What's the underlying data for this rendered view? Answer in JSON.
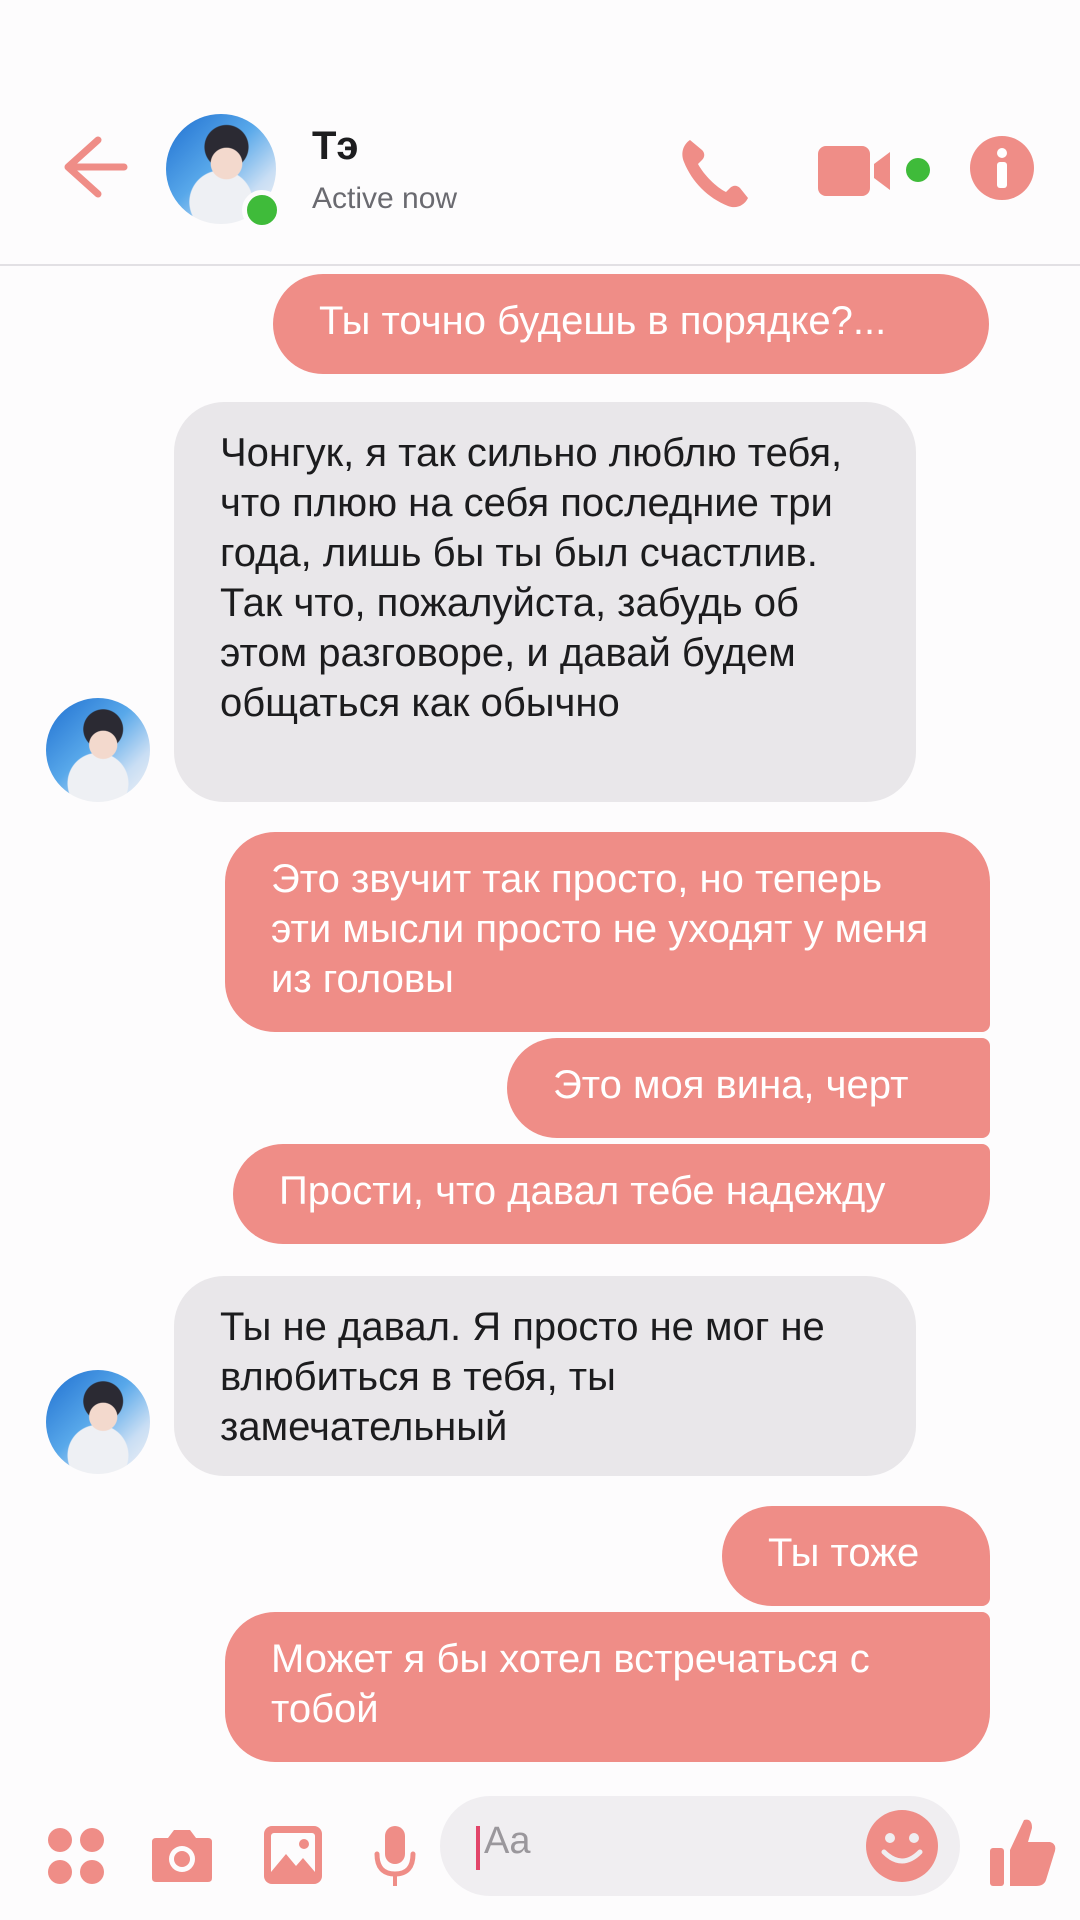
{
  "header": {
    "back_icon": "back-arrow-icon",
    "contact_name": "Тэ",
    "status": "Active now",
    "icons": [
      "phone-icon",
      "video-camera-icon",
      "info-icon"
    ]
  },
  "messages": [
    {
      "side": "sent",
      "text": "Ты точно будешь в порядке?..."
    },
    {
      "side": "received",
      "text": "Чонгук, я так сильно люблю тебя, что плюю на себя последние три года, лишь бы ты был счастлив. Так что, пожалуйста, забудь об этом разговоре, и давай будем общаться как обычно"
    },
    {
      "side": "sent",
      "text": "Это звучит так просто, но теперь эти мысли просто не уходят у меня из головы"
    },
    {
      "side": "sent",
      "text": "Это моя вина, черт"
    },
    {
      "side": "sent",
      "text": "Прости, что давал тебе надежду"
    },
    {
      "side": "received",
      "text": "Ты не давал. Я просто не мог не влюбиться в тебя, ты замечательный"
    },
    {
      "side": "sent",
      "text": "Ты тоже"
    },
    {
      "side": "sent",
      "text": "Может я бы хотел встречаться с тобой"
    }
  ],
  "composer": {
    "icons": [
      "apps-grid-icon",
      "camera-icon",
      "image-icon",
      "microphone-icon",
      "emoji-icon",
      "thumbs-up-icon"
    ],
    "placeholder": "Aa"
  },
  "colors": {
    "accent": "#ef8d87",
    "received_bubble": "#e9e7ea",
    "online": "#3fbb3a"
  }
}
